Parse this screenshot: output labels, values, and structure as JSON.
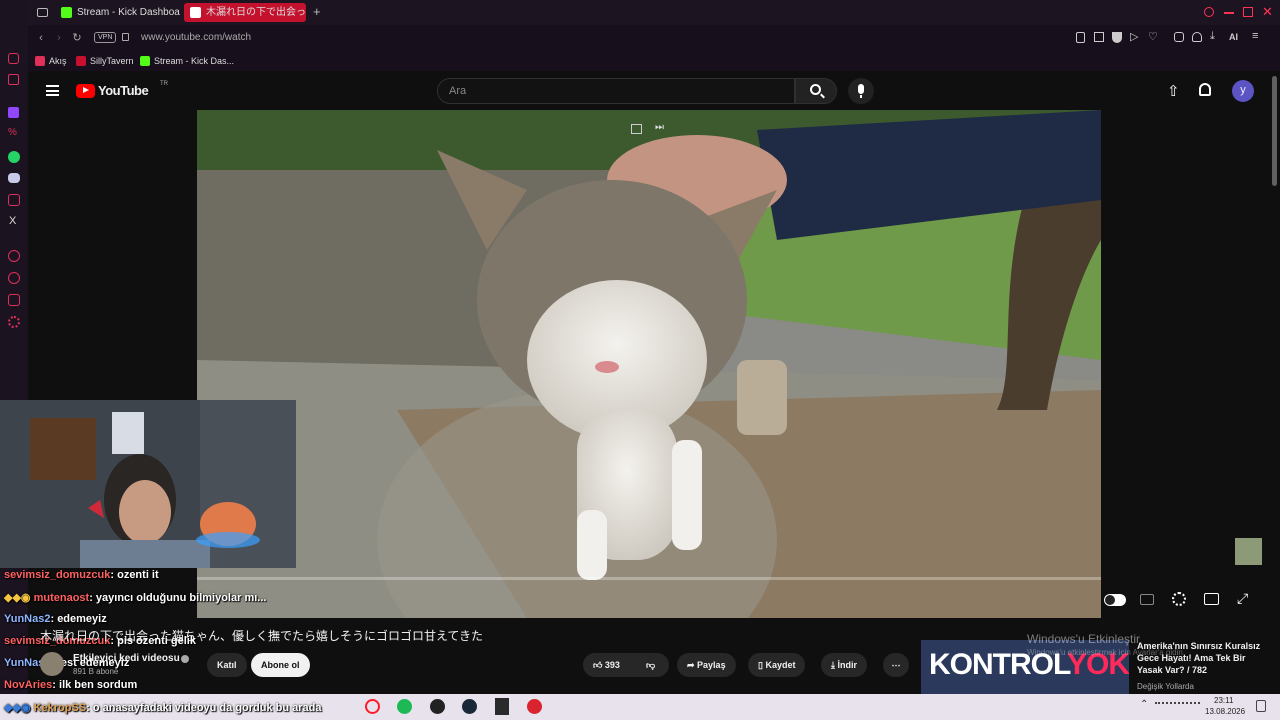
{
  "browser": {
    "tabs": [
      {
        "label": "Stream - Kick Dashboard",
        "color": "#53fc18"
      },
      {
        "label": "木漏れ日の下で出会った仔",
        "color": "#ff0000"
      }
    ],
    "add_tab": "+",
    "vpn_label": "VPN",
    "url": "www.youtube.com/watch",
    "ai_label": "AI",
    "bookmarks": [
      "Akış",
      "SillyTavern",
      "Stream - Kick Das..."
    ]
  },
  "youtube": {
    "logo_text": "YouTube",
    "region": "TR",
    "search_placeholder": "Ara",
    "avatar_letter": "y"
  },
  "video": {
    "subtitle": "木漏れ日の下で出会った猫ちゃん、優しく撫でたら嬉しそうにゴロゴロ甘えてきた",
    "channel_name": "Etkileyici kedi videosu",
    "subscribers": "891 B abone",
    "join_label": "Katıl",
    "subscribe_label": "Abone ol",
    "likes": "393",
    "share_label": "Paylaş",
    "save_label": "Kaydet",
    "download_label": "İndir",
    "more_label": "⋯"
  },
  "chat": [
    {
      "user": "sevimsiz_domuzcuk",
      "msg": ": ozenti it",
      "cls": "u3"
    },
    {
      "user": "mutenaost",
      "msg": ": yayıncı olduğunu bilmiyolar mı...",
      "cls": "u3"
    },
    {
      "user": "YunNas2",
      "msg": ": edemeyiz",
      "cls": "u2"
    },
    {
      "user": "sevimsiz_domuzcuk",
      "msg": ": pis ozenti gelik",
      "cls": "u3"
    },
    {
      "user": "YunNas2",
      "msg": ": test edemeyiz",
      "cls": "u2"
    },
    {
      "user": "NovAries",
      "msg": ": ilk ben sordum",
      "cls": "u3"
    },
    {
      "user": "KekropSS",
      "msg": ": o anasayfadaki videoyu da gorduk bu arada",
      "cls": "u"
    }
  ],
  "recommendation": {
    "thumb_text_1": "KONTROL",
    "thumb_text_2": "YOK",
    "title": "Amerika'nın Sınırsız Kuralsız Gece Hayatı! Ama Tek Bir Yasak Var? / 782",
    "channel": "Değişik Yollarda"
  },
  "watermark": {
    "line1": "Windows'u Etkinleştir",
    "line2": "Windows'u etkinleştirmek için Ayarlar'a gidin."
  },
  "taskbar": {
    "time": "23:11",
    "date": "13.08.2026"
  }
}
